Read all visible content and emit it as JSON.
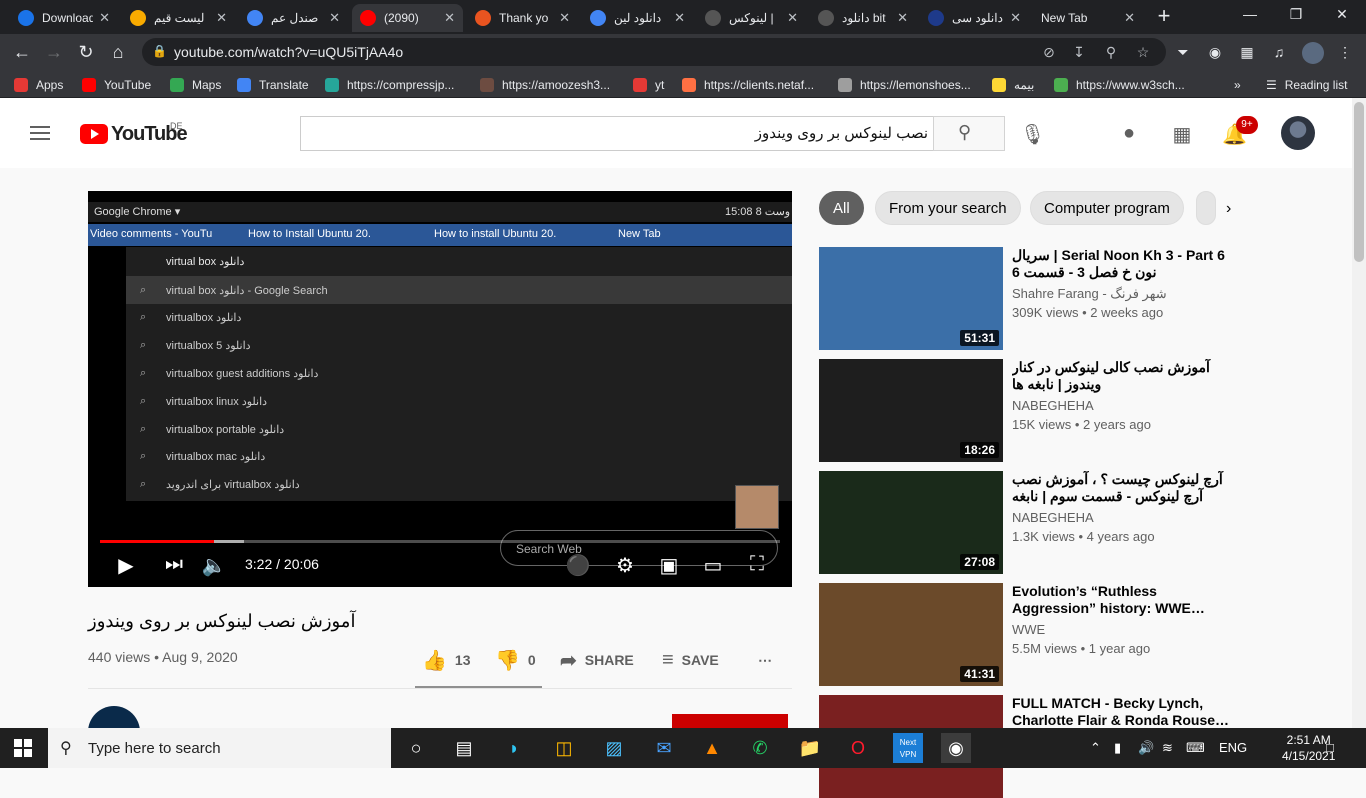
{
  "browser": {
    "tabs": [
      {
        "title": "Download",
        "icon": "download-icon",
        "color": "#1a73e8"
      },
      {
        "title": "لیست قیم",
        "icon": "emoji-icon",
        "color": "#f9ab00"
      },
      {
        "title": "صندل عم",
        "icon": "google-icon",
        "color": "#4285f4"
      },
      {
        "title": "(2090)",
        "icon": "youtube-icon",
        "color": "#ff0000"
      },
      {
        "title": "Thank yo",
        "icon": "ubuntu-icon",
        "color": "#e95420"
      },
      {
        "title": "دانلود لین",
        "icon": "google-icon",
        "color": "#4285f4"
      },
      {
        "title": "لینوکس |",
        "icon": "page-icon",
        "color": "#555555"
      },
      {
        "title": "دانلود bit",
        "icon": "page-icon",
        "color": "#555555"
      },
      {
        "title": "دانلود سی",
        "icon": "site-icon",
        "color": "#1e3a8a"
      },
      {
        "title": "New Tab",
        "icon": "",
        "color": ""
      }
    ],
    "url": "youtube.com/watch?v=uQU5iTjAA4o",
    "bookmarks": [
      {
        "label": "Apps",
        "color": "#e53935"
      },
      {
        "label": "YouTube",
        "color": "#ff0000"
      },
      {
        "label": "Maps",
        "color": "#34a853"
      },
      {
        "label": "Translate",
        "color": "#4285f4"
      },
      {
        "label": "https://compressjp...",
        "color": "#26a69a"
      },
      {
        "label": "https://amoozesh3...",
        "color": "#6d4c41"
      },
      {
        "label": "yt",
        "color": "#e53935"
      },
      {
        "label": "https://clients.netaf...",
        "color": "#ff7043"
      },
      {
        "label": "https://lemonshoes...",
        "color": "#9e9e9e"
      },
      {
        "label": "بیمه",
        "color": "#fdd835"
      },
      {
        "label": "https://www.w3sch...",
        "color": "#4caf50"
      }
    ],
    "reading_list": "Reading list"
  },
  "youtube": {
    "logo_text": "YouTube",
    "region": "DE",
    "search_query": "نصب لینوکس بر روی ویندوز",
    "notifications": "9+",
    "video": {
      "title": "آموزش نصب لینوکس بر روی ویندوز",
      "views": "440 views • Aug 9, 2020",
      "time": "3:22 / 20:06",
      "progress_fraction": 0.168,
      "likes": "13",
      "dislikes": "0",
      "share": "SHARE",
      "save": "SAVE"
    },
    "player_screen": {
      "app_label": "Google Chrome ▾",
      "clock": "15:08  8 وست",
      "tabs": [
        "Video comments - YouTu",
        "How to Install Ubuntu 20.",
        "How to install Ubuntu 20.",
        "New Tab"
      ],
      "query": "virtual box دانلود",
      "suggestions": [
        "virtual box دانلود - Google Search",
        "virtualbox دانلود",
        "virtualbox 5 دانلود",
        "virtualbox guest additions دانلود",
        "virtualbox linux دانلود",
        "virtualbox portable دانلود",
        "virtualbox mac دانلود",
        "برای اندروید virtualbox دانلود"
      ],
      "search_web": "Search Web"
    },
    "chips": [
      "All",
      "From your search",
      "Computer program"
    ],
    "recommendations": [
      {
        "title": "سریال | Serial Noon Kh 3 - Part 6 نون خ فصل 3 - قسمت 6",
        "channel": "Shahre Farang - شهر فرنگ",
        "meta": "309K views • 2 weeks ago",
        "duration": "51:31",
        "bg": "#3b6fa8"
      },
      {
        "title": "آموزش نصب کالی لینوکس در کنار ویندوز | نابغه ها",
        "channel": "NABEGHEHA",
        "meta": "15K views • 2 years ago",
        "duration": "18:26",
        "bg": "#1e1e1e"
      },
      {
        "title": "آرچ لینوکس چیست ؟ ، آموزش نصب آرچ لینوکس - قسمت سوم | نابغه",
        "channel": "NABEGHEHA",
        "meta": "1.3K views • 4 years ago",
        "duration": "27:08",
        "bg": "#1a2a1a"
      },
      {
        "title": "Evolution’s “Ruthless Aggression” history: WWE…",
        "channel": "WWE",
        "meta": "5.5M views • 1 year ago",
        "duration": "41:31",
        "bg": "#6b4a2a"
      },
      {
        "title": "FULL MATCH - Becky Lynch, Charlotte Flair & Ronda Rouse…",
        "channel": "",
        "meta": "",
        "duration": "",
        "bg": "#7a2020"
      }
    ]
  },
  "taskbar": {
    "search_placeholder": "Type here to search",
    "language": "ENG",
    "time": "2:51 AM",
    "date": "4/15/2021"
  }
}
